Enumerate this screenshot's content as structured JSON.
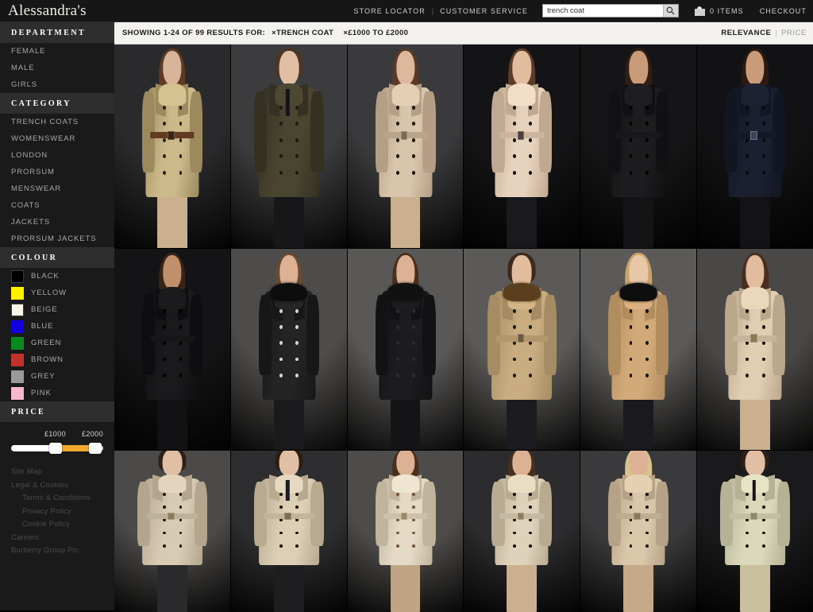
{
  "header": {
    "brand": "Alessandra's",
    "nav": [
      {
        "label": "STORE LOCATOR",
        "name": "store-locator"
      },
      {
        "label": "CUSTOMER SERVICE",
        "name": "customer-service"
      }
    ],
    "separator": "|",
    "search": {
      "value": "trench coat",
      "placeholder": "Search",
      "icon": "search-icon"
    },
    "cart": {
      "icon": "shopping-bag-icon",
      "label": "0 ITEMS"
    },
    "checkout": "CHECKOUT"
  },
  "results": {
    "showing": "SHOWING 1-24 OF 99 RESULTS FOR:",
    "chips": [
      {
        "label": "×TRENCH COAT",
        "name": "filter-chip-trench-coat"
      },
      {
        "label": "×£1000 TO £2000",
        "name": "filter-chip-price"
      }
    ],
    "sort": {
      "active": "RELEVANCE",
      "separator": "|",
      "inactive": "PRICE"
    }
  },
  "sidebar": {
    "sections": [
      {
        "title": "DEPARTMENT",
        "name": "department",
        "items": [
          "FEMALE",
          "MALE",
          "GIRLS"
        ]
      },
      {
        "title": "CATEGORY",
        "name": "category",
        "items": [
          "TRENCH COATS",
          "WOMENSWEAR",
          "LONDON",
          "PRORSUM",
          "MENSWEAR",
          "COATS",
          "JACKETS",
          "PRORSUM JACKETS"
        ]
      }
    ],
    "colour": {
      "title": "COLOUR",
      "items": [
        {
          "label": "BLACK",
          "hex": "#000000"
        },
        {
          "label": "YELLOW",
          "hex": "#fff200"
        },
        {
          "label": "BEIGE",
          "hex": "#f7f4e8"
        },
        {
          "label": "BLUE",
          "hex": "#1200e0"
        },
        {
          "label": "GREEN",
          "hex": "#0a8a1e"
        },
        {
          "label": "BROWN",
          "hex": "#c0322c"
        },
        {
          "label": "GREY",
          "hex": "#9a9a9a"
        },
        {
          "label": "PINK",
          "hex": "#f7b8ce"
        }
      ]
    },
    "price": {
      "title": "PRICE",
      "min_label": "£1000",
      "max_label": "£2000",
      "range_color": "#f0a830"
    },
    "footer_links": [
      {
        "label": "Site Map",
        "indent": false
      },
      {
        "label": "Legal & Cookies",
        "indent": false
      },
      {
        "label": "Terms & Conditions",
        "indent": true
      },
      {
        "label": "Privacy Policy",
        "indent": true
      },
      {
        "label": "Cookie Policy",
        "indent": true
      },
      {
        "label": "Careers",
        "indent": false
      },
      {
        "label": "Burberry Group Plc",
        "indent": false
      }
    ]
  },
  "grid": {
    "columns": 6,
    "rows": 3,
    "products": [
      {
        "name": "product-tile-1",
        "alt": "Metallic gold trench coat with belt over printed shorts",
        "bg": "#2a2a2c",
        "coat": "#cbb98a",
        "coat2": "#9c8a5e",
        "skin": "#d8b49a",
        "hair": "#5e3a26",
        "legs": "#cbb08f",
        "collar": "#cbb98a",
        "btn": "#2a2318",
        "belt": "#6b4024",
        "buckle": "#3a2414",
        "fur": "none",
        "tie": "none",
        "fig": "tall"
      },
      {
        "name": "product-tile-2",
        "alt": "Olive green cotton gabardine trench coat, men's",
        "bg": "#3c3c3e",
        "coat": "#4a4530",
        "coat2": "#353122",
        "skin": "#e0bfa4",
        "hair": "#4a3526",
        "legs": "#17171a",
        "collar": "#4a4530",
        "btn": "#1e1b12",
        "belt": "none",
        "buckle": "none",
        "fur": "none",
        "tie": "#14141a",
        "fig": "male"
      },
      {
        "name": "product-tile-3",
        "alt": "Stone beige satin trench coat with buckle belt",
        "bg": "#3a3a3c",
        "coat": "#d9c5ab",
        "coat2": "#b49f86",
        "skin": "#ddb89c",
        "hair": "#5a3a27",
        "legs": "#cbb08f",
        "collar": "#d9c5ab",
        "btn": "#1c1712",
        "belt": "#c9b396",
        "buckle": "#7c6a52",
        "fur": "none",
        "tie": "none",
        "fig": "tall"
      },
      {
        "name": "product-tile-4",
        "alt": "Pale pink satin trench coat with belt",
        "bg": "#141416",
        "coat": "#e6d2bd",
        "coat2": "#c0a990",
        "skin": "#e2bc9e",
        "hair": "#5c3c28",
        "legs": "#1a1a1e",
        "collar": "#e6d2bd",
        "btn": "#15110d",
        "belt": "#dcc6ad",
        "buckle": "#4c4038",
        "fur": "none",
        "tie": "none",
        "fig": "tall"
      },
      {
        "name": "product-tile-5",
        "alt": "Black wool trench coat with tie belt",
        "bg": "#151517",
        "coat": "#1d1d20",
        "coat2": "#111113",
        "skin": "#c99b78",
        "hair": "#301e14",
        "legs": "#141417",
        "collar": "#1d1d20",
        "btn": "#000000",
        "belt": "#1a1a1d",
        "buckle": "none",
        "fur": "none",
        "tie": "none",
        "fig": "tall"
      },
      {
        "name": "product-tile-6",
        "alt": "Navy blue trench coat with buckle belt",
        "bg": "#121214",
        "coat": "#1b2030",
        "coat2": "#121622",
        "skin": "#c99b78",
        "hair": "#2a1a12",
        "legs": "#131317",
        "collar": "#1b2030",
        "btn": "#070a12",
        "belt": "#161b28",
        "buckle": "#3c4458",
        "fur": "none",
        "tie": "none",
        "fig": "tall"
      },
      {
        "name": "product-tile-7",
        "alt": "Black satin trench coat on dark background",
        "bg": "#141416",
        "coat": "#1a1a1c",
        "coat2": "#0e0e10",
        "skin": "#c08f6c",
        "hair": "#3a2418",
        "legs": "#121214",
        "collar": "#1a1a1c",
        "btn": "#000000",
        "belt": "#18181a",
        "buckle": "none",
        "fur": "none",
        "tie": "none",
        "fig": "tall"
      },
      {
        "name": "product-tile-8",
        "alt": "Black wool coat with black fur collar",
        "bg": "#4e4c4a",
        "coat": "#242424",
        "coat2": "#171717",
        "skin": "#dcb194",
        "hair": "#6b4a30",
        "legs": "#1a1a1c",
        "collar": "#242424",
        "btn": "#d8d4cc",
        "belt": "none",
        "buckle": "none",
        "fur": "#0d0d0d",
        "tie": "none",
        "fig": "tall"
      },
      {
        "name": "product-tile-9",
        "alt": "Black coat with shearling fur collar",
        "bg": "#5a5856",
        "coat": "#1c1c1e",
        "coat2": "#121214",
        "skin": "#dcb194",
        "hair": "#4a2f1e",
        "legs": "#141416",
        "collar": "#1c1c1e",
        "btn": "#2c2c30",
        "belt": "none",
        "buckle": "none",
        "fur": "#111111",
        "tie": "none",
        "fig": "tall"
      },
      {
        "name": "product-tile-10",
        "alt": "Honey camel trench coat with brown fur collar",
        "bg": "#5c5a58",
        "coat": "#c9ac80",
        "coat2": "#a68c64",
        "skin": "#e2bc9e",
        "hair": "#3e2a1c",
        "legs": "#1c1c20",
        "collar": "#c9ac80",
        "btn": "#1d1913",
        "belt": "#c2a477",
        "buckle": "#6e5a3c",
        "fur": "#5a3e1e",
        "tie": "none",
        "fig": "male"
      },
      {
        "name": "product-tile-11",
        "alt": "Camel wool coat with black fur collar",
        "bg": "#5c5a58",
        "coat": "#d2a979",
        "coat2": "#b08c5e",
        "skin": "#e8c7a8",
        "hair": "#c8a46a",
        "legs": "#1a1a1e",
        "collar": "#d2a979",
        "btn": "#18140e",
        "belt": "none",
        "buckle": "none",
        "fur": "#0e0e0e",
        "tie": "none",
        "fig": "tall"
      },
      {
        "name": "product-tile-12",
        "alt": "Beige gabardine trench coat with belt",
        "bg": "#4a4846",
        "coat": "#e0cdb2",
        "coat2": "#bba78c",
        "skin": "#e2bc9e",
        "hair": "#4a2e1e",
        "legs": "#cbb08f",
        "collar": "#e0cdb2",
        "btn": "#1a1510",
        "belt": "#d8c4a8",
        "buckle": "#8c7856",
        "fur": "none",
        "tie": "none",
        "fig": "tall"
      },
      {
        "name": "product-tile-13",
        "alt": "Stone trench coat, men's, with belt",
        "bg": "#4c4a48",
        "coat": "#d8cbb4",
        "coat2": "#b4a68e",
        "skin": "#e0bfa4",
        "hair": "#2c2018",
        "legs": "#2a2a2c",
        "collar": "#d8cbb4",
        "btn": "#1c1712",
        "belt": "#cfc0a6",
        "buckle": "#8a7a5e",
        "fur": "none",
        "tie": "none",
        "fig": "male"
      },
      {
        "name": "product-tile-14",
        "alt": "Honey trench coat, men's, with buckle belt",
        "bg": "#2e2e30",
        "coat": "#dccfb6",
        "coat2": "#b8aa90",
        "skin": "#e0bfa4",
        "hair": "#2a1e16",
        "legs": "#1e1e20",
        "collar": "#dccfb6",
        "btn": "#16120d",
        "belt": "#d2c4a8",
        "buckle": "#7c6c50",
        "fur": "none",
        "tie": "#1a1a20",
        "fig": "male"
      },
      {
        "name": "product-tile-15",
        "alt": "Pale stone trench coat with thin belt",
        "bg": "#4e4c4a",
        "coat": "#e4dac6",
        "coat2": "#c0b49c",
        "skin": "#dcb194",
        "hair": "#4a2e1e",
        "legs": "#bfa585",
        "collar": "#e4dac6",
        "btn": "#7a5434",
        "belt": "#ded2bc",
        "buckle": "#9a8866",
        "fur": "none",
        "tie": "none",
        "fig": "tall"
      },
      {
        "name": "product-tile-16",
        "alt": "Beige trench coat with black buttons and belt",
        "bg": "#2c2c2e",
        "coat": "#ded2bb",
        "coat2": "#b8ab92",
        "skin": "#dcb194",
        "hair": "#46301f",
        "legs": "#cbb08f",
        "collar": "#ded2bb",
        "btn": "#141210",
        "belt": "#d6c8b0",
        "buckle": "#8e7c5e",
        "fur": "none",
        "tie": "none",
        "fig": "tall"
      },
      {
        "name": "product-tile-17",
        "alt": "Honey trench coat with belt, women's",
        "bg": "#3a3a3c",
        "coat": "#dac7aa",
        "coat2": "#b6a286",
        "skin": "#dcb194",
        "hair": "#d8c28e",
        "legs": "#c4a888",
        "collar": "#dac7aa",
        "btn": "#171410",
        "belt": "#d0bc9e",
        "buckle": "#8a7656",
        "fur": "none",
        "tie": "none",
        "fig": "tall"
      },
      {
        "name": "product-tile-18",
        "alt": "Pale sage trench coat with clutch bag",
        "bg": "#1a1a1c",
        "coat": "#dcd8bc",
        "coat2": "#b6b296",
        "skin": "#e0bfa4",
        "hair": "#2e2018",
        "legs": "#cabf9e",
        "collar": "#dcd8bc",
        "btn": "#14120c",
        "belt": "#d4d0b2",
        "buckle": "#8c8868",
        "fur": "none",
        "tie": "#15151a",
        "fig": "male"
      }
    ]
  }
}
